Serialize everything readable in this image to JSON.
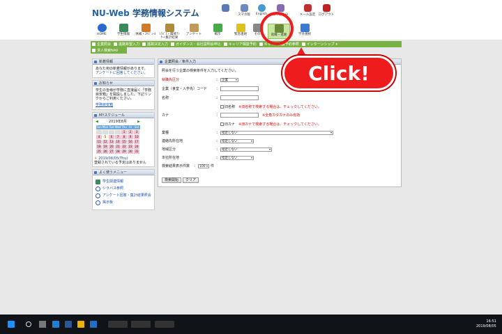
{
  "app": {
    "title_nu": "NU-Web",
    "title_rest": " 学務情報システム"
  },
  "utility_links": [
    {
      "label": "",
      "icon": "person-icon"
    },
    {
      "label": "スマホ版",
      "icon": "smartphone-icon"
    },
    {
      "label": "English",
      "icon": "globe-icon"
    },
    {
      "label": "振り返り分",
      "icon": "clock-icon"
    },
    {
      "label": "メール設定",
      "icon": "mail-settings-icon"
    },
    {
      "label": "ログアウト",
      "icon": "logout-icon"
    }
  ],
  "nav": [
    {
      "label": "HOME",
      "icon": "home-icon"
    },
    {
      "label": "学生情報",
      "icon": "student-info-icon"
    },
    {
      "label": "休補・ｽｹｼﾞｭｰﾙ",
      "icon": "schedule-icon"
    },
    {
      "label": "ｼﾗﾊﾞｽ・履修ｱﾝｹｰﾄ集計結果",
      "icon": "syllabus-icon"
    },
    {
      "label": "アンケート",
      "icon": "survey-icon"
    },
    {
      "label": "掲示",
      "icon": "board-icon"
    },
    {
      "label": "緊急連絡",
      "icon": "emergency-icon"
    },
    {
      "label": "その",
      "icon": "other-icon"
    },
    {
      "label": "就職・進路",
      "icon": "career-icon"
    },
    {
      "label": "学外選択",
      "icon": "external-icon"
    }
  ],
  "menubar": [
    "企業照会",
    "進路希望入力",
    "進路決定入力",
    "ガイダンス・会社説明会申込",
    "キャリア相談予約",
    "キャリア相談予約参照",
    "インターンシップ"
  ],
  "menubar2": [
    "求人検索NAV"
  ],
  "sidebar": {
    "new_info": {
      "title": "新着情報",
      "text": "あなた宛の新着情報があります。",
      "link": "アンケートに回答してください。"
    },
    "notice": {
      "title": "お知らせ",
      "text": "学生の皆様が学務に直接届く「学務目安箱」を開設しました。下記リンクからご利用ください。",
      "link": "学務目安箱"
    },
    "schedule": {
      "title": "MYスケジュール",
      "month": "2019年8月",
      "prev": "◀",
      "next": "▶",
      "days": [
        "Sun",
        "Mon",
        "Tue",
        "Wed",
        "Thu",
        "Fri",
        "Sat"
      ],
      "weeks": [
        [
          "",
          "",
          "",
          "",
          "1",
          "2",
          "3"
        ],
        [
          "4",
          "5",
          "6",
          "7",
          "8",
          "9",
          "10"
        ],
        [
          "11",
          "12",
          "13",
          "14",
          "15",
          "16",
          "17"
        ],
        [
          "18",
          "19",
          "20",
          "21",
          "22",
          "23",
          "24"
        ],
        [
          "25",
          "26",
          "27",
          "28",
          "29",
          "30",
          "31"
        ]
      ],
      "date": "2019/08/05(Thu)",
      "empty": "登録されている予定はありません"
    },
    "favorites": {
      "title": "よく使うメニュー",
      "items": [
        "学生関連情報",
        "シラバス参照",
        "アンケート回答・集計結果照会",
        "掲示板"
      ]
    }
  },
  "main": {
    "title": "企業照会／条件入力",
    "intro": "照会を行う企業の検索条件を入力してください。",
    "fields": {
      "category": {
        "label": "就職先区分",
        "value": "企業"
      },
      "code": {
        "label": "企業（食堂・入学先）コード"
      },
      "name": {
        "label": "名称",
        "check": "旧名称",
        "note": "※旧名称で検索する場合は、チェックしてください。"
      },
      "kana": {
        "label": "カナ",
        "hint": "※全角カタカナのみ有効",
        "check": "旧カナ",
        "note": "※旧カナで検索する場合は、チェックしてください。"
      },
      "industry": {
        "label": "業種",
        "value": "指定しない"
      },
      "contact": {
        "label": "連絡先所在地",
        "value": "指定しない"
      },
      "region": {
        "label": "地域区分",
        "value": "指定しない"
      },
      "hq": {
        "label": "本社所在地",
        "value": "指定しない"
      },
      "count": {
        "label": "検索結果表示件数",
        "value": "100",
        "unit": "件"
      }
    },
    "buttons": {
      "search": "検索開始",
      "clear": "クリア"
    }
  },
  "callout": {
    "text": "Click!"
  },
  "taskbar": {
    "time": "16:51",
    "date": "2019/08/05"
  }
}
